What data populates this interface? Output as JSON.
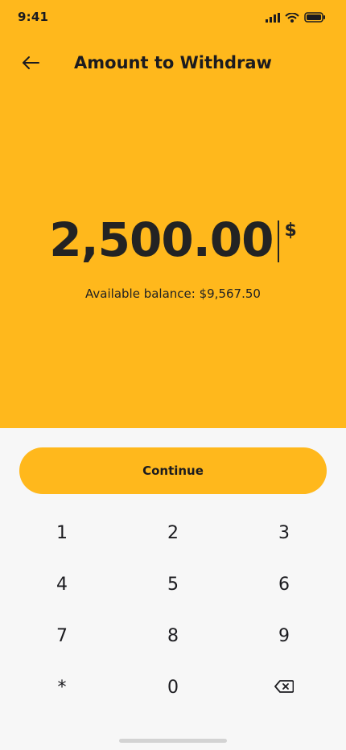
{
  "status_bar": {
    "time": "9:41",
    "icons": [
      "signal-icon",
      "wifi-icon",
      "battery-icon"
    ]
  },
  "header": {
    "title": "Amount to Withdraw",
    "back_icon": "back-arrow-icon"
  },
  "amount": {
    "value": "2,500.00",
    "currency": "$"
  },
  "balance": {
    "text": "Available balance: $9,567.50"
  },
  "actions": {
    "continue_label": "Continue"
  },
  "keypad": {
    "rows": [
      [
        "1",
        "2",
        "3"
      ],
      [
        "4",
        "5",
        "6"
      ],
      [
        "7",
        "8",
        "9"
      ],
      [
        "*",
        "0",
        "backspace-icon"
      ]
    ]
  },
  "colors": {
    "accent": "#ffb81c",
    "background": "#f7f7f7",
    "text": "#1b1b1f"
  }
}
